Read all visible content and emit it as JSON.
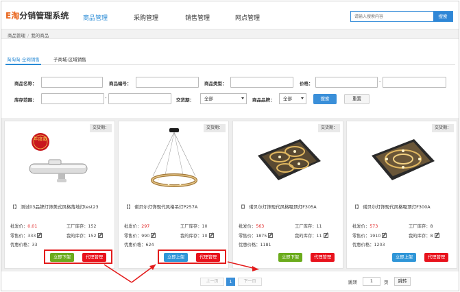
{
  "header": {
    "logo_brand": "E淘",
    "logo_text": "分销管理系统",
    "nav": [
      "商品管理",
      "采购管理",
      "销售管理",
      "网点管理"
    ],
    "active_nav": 0,
    "search_placeholder": "请输入搜索内容",
    "search_button": "搜索"
  },
  "breadcrumb": {
    "items": [
      "商品管理",
      "我的商品"
    ],
    "separator": "/"
  },
  "tabs": [
    "淘淘淘-全网销售",
    "子商城-区域销售"
  ],
  "filters": {
    "product_name": "商品名称：",
    "product_code": "商品编号：",
    "product_type": "商品类型：",
    "price": "价格：",
    "stock_range": "库存范围：",
    "deal_period": "交货期：",
    "deal_period_value": "全部",
    "brand": "商品品牌：",
    "brand_value": "全部",
    "range_dash": "-",
    "search_button": "搜索",
    "reset_button": "重置"
  },
  "labels": {
    "wholesale": "批发价：",
    "retail": "零售价：",
    "discount": "优惠价格：",
    "factory_stock": "工厂库存：",
    "my_stock": "我的库存："
  },
  "products": [
    {
      "deal": "交货期：",
      "name": "【】 测试03品牌灯饰美式风格落地灯test23",
      "wholesale": "0.01",
      "factory_stock": "152",
      "retail": "333",
      "my_stock": "152",
      "discount": "33",
      "action": "立即下架",
      "agent": "代理管理",
      "icon": "faucet-image",
      "badge": "年度款"
    },
    {
      "deal": "交货期：",
      "name": "【】 诺贝尔灯饰现代风格吊灯P257A",
      "wholesale": "297",
      "factory_stock": "10",
      "retail": "990",
      "my_stock": "10",
      "discount": "624",
      "action": "立即上架",
      "agent": "代理管理",
      "icon": "pendant-lamp-image"
    },
    {
      "deal": "交货期：",
      "name": "【】 诺贝尔灯饰现代风格吸顶灯F305A",
      "wholesale": "563",
      "factory_stock": "11",
      "retail": "1875",
      "my_stock": "11",
      "discount": "1181",
      "action": "立即下架",
      "agent": "代理管理",
      "icon": "ceiling-lamp-image"
    },
    {
      "deal": "交货期：",
      "name": "【】 诺贝尔灯饰现代风格吸顶灯F300A",
      "wholesale": "573",
      "factory_stock": "8",
      "retail": "1910",
      "my_stock": "8",
      "discount": "1203",
      "action": "立即上架",
      "agent": "代理管理",
      "icon": "ceiling-lamp-image"
    }
  ],
  "pagination": {
    "prev": "上一页",
    "current": "1",
    "next": "下一页",
    "jump_label": "跳转",
    "page_value": "1",
    "page_unit": "页",
    "jump_button": "跳转"
  },
  "colors": {
    "accent": "#2a8bd6",
    "brand_orange": "#e8641a",
    "price_red": "#e02020",
    "green_button": "#6bab1c",
    "blue_button": "#2f96d8",
    "red_button": "#e8121c",
    "annotation_red": "#e31b1b"
  }
}
